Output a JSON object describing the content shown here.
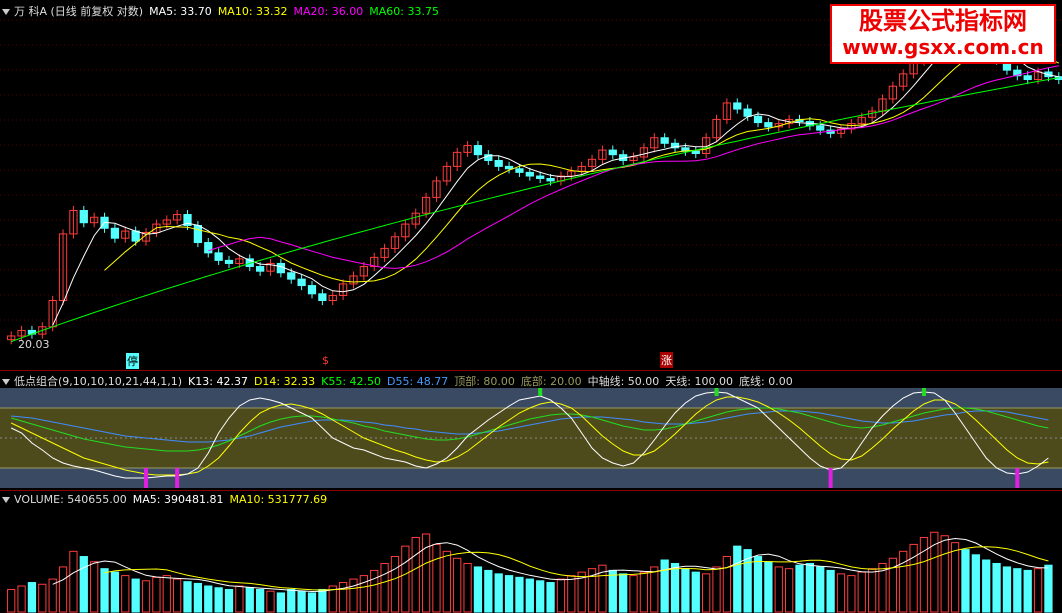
{
  "price_header": {
    "title": "万 科A (日线 前复权 对数)",
    "ma5": "MA5: 33.70",
    "ma10": "MA10: 33.32",
    "ma20": "MA20: 36.00",
    "ma60": "MA60: 33.75",
    "colors": {
      "ma5": "#ffffff",
      "ma10": "#ffff00",
      "ma20": "#ff00ff",
      "ma60": "#00ff00"
    }
  },
  "watermark": {
    "title": "股票公式指标网",
    "url": "www.gsxx.com.cn"
  },
  "low_label": "20.03",
  "markers": {
    "ting": "停",
    "jin": "$",
    "zhang": "涨"
  },
  "osc_header": {
    "name": "低点组合(9,10,10,10,21,44,1,1)",
    "k13": "K13: 42.37",
    "d14": "D14: 32.33",
    "k55": "K55: 42.50",
    "d55": "D55: 48.77",
    "top": "顶部: 80.00",
    "bottom": "底部: 20.00",
    "mid": "中轴线: 50.00",
    "sky": "天线: 100.00",
    "floor": "底线: 0.00"
  },
  "vol_header": {
    "volume": "VOLUME: 540655.00",
    "ma5": "MA5: 390481.81",
    "ma10": "MA10: 531777.69"
  },
  "chart_data": {
    "type": "candlestick",
    "price_range": [
      19.5,
      47
    ],
    "closes": [
      20.5,
      20.8,
      20.6,
      21.0,
      22.5,
      26.8,
      28.5,
      27.6,
      28.0,
      27.2,
      26.5,
      27.0,
      26.3,
      26.9,
      27.5,
      27.8,
      28.2,
      27.4,
      26.2,
      25.5,
      25.0,
      24.8,
      25.1,
      24.6,
      24.3,
      24.8,
      24.2,
      23.8,
      23.4,
      22.9,
      22.5,
      22.8,
      23.5,
      24.0,
      24.6,
      25.2,
      25.8,
      26.6,
      27.5,
      28.3,
      29.5,
      30.8,
      32.0,
      33.2,
      33.8,
      33.0,
      32.5,
      32.0,
      31.8,
      31.5,
      31.2,
      31.0,
      30.8,
      31.2,
      31.6,
      32.0,
      32.6,
      33.4,
      33.0,
      32.5,
      32.8,
      33.6,
      34.5,
      34.0,
      33.6,
      33.3,
      33.1,
      34.5,
      36.2,
      37.8,
      37.2,
      36.5,
      35.9,
      35.5,
      35.8,
      36.2,
      36.0,
      35.6,
      35.2,
      34.9,
      35.3,
      35.8,
      36.4,
      37.0,
      38.2,
      39.5,
      40.8,
      42.2,
      43.5,
      44.8,
      45.6,
      46.2,
      45.6,
      44.6,
      43.4,
      42.3,
      41.2,
      40.6,
      40.2,
      41.0,
      40.5,
      40.2
    ],
    "opens": [
      20.3,
      20.5,
      20.8,
      20.6,
      21.0,
      22.5,
      26.8,
      28.5,
      27.6,
      28.0,
      27.2,
      26.5,
      27.0,
      26.3,
      26.9,
      27.5,
      27.8,
      28.2,
      27.4,
      26.2,
      25.5,
      25.0,
      24.8,
      25.1,
      24.6,
      24.3,
      24.8,
      24.2,
      23.8,
      23.4,
      22.9,
      22.5,
      22.8,
      23.5,
      24.0,
      24.6,
      25.2,
      25.8,
      26.6,
      27.5,
      28.3,
      29.5,
      30.8,
      32.0,
      33.2,
      33.8,
      33.0,
      32.5,
      32.0,
      31.8,
      31.5,
      31.2,
      31.0,
      30.8,
      31.2,
      31.6,
      32.0,
      32.6,
      33.4,
      33.0,
      32.5,
      32.8,
      33.6,
      34.5,
      34.0,
      33.6,
      33.3,
      33.1,
      34.5,
      36.2,
      37.8,
      37.2,
      36.5,
      35.9,
      35.5,
      35.8,
      36.2,
      36.0,
      35.6,
      35.2,
      34.9,
      35.3,
      35.8,
      36.4,
      37.0,
      38.2,
      39.5,
      40.8,
      42.2,
      43.5,
      44.8,
      45.6,
      46.2,
      45.6,
      44.6,
      43.4,
      42.3,
      41.2,
      40.6,
      40.2,
      41.0,
      40.5
    ],
    "ma60": [
      20.2,
      20.4,
      20.6,
      20.8,
      21.0,
      21.2,
      21.4,
      21.6,
      21.8,
      22.0,
      22.2,
      22.4,
      22.6,
      22.8,
      23.0,
      23.2,
      23.4,
      23.6,
      23.8,
      24.0,
      24.2,
      24.4,
      24.6,
      24.8,
      25.0,
      25.2,
      25.4,
      25.6,
      25.8,
      26.0,
      26.2,
      26.4,
      26.6,
      26.8,
      27.0,
      27.2,
      27.4,
      27.6,
      27.8,
      28.0,
      28.2,
      28.4,
      28.6,
      28.8,
      29.0,
      29.2,
      29.4,
      29.6,
      29.8,
      30.0,
      30.2,
      30.4,
      30.6,
      30.8,
      31.0,
      31.2,
      31.4,
      31.6,
      31.8,
      32.0,
      32.2,
      32.4,
      32.6,
      32.8,
      33.0,
      33.2,
      33.4,
      33.6,
      33.8,
      34.0,
      34.2,
      34.4,
      34.6,
      34.8,
      35.0,
      35.2,
      35.4,
      35.6,
      35.8,
      36.0,
      36.2,
      36.4,
      36.6,
      36.8,
      37.0,
      37.2,
      37.4,
      37.6,
      37.8,
      38.0,
      38.2,
      38.4,
      38.6,
      38.8,
      39.0,
      39.2,
      39.4,
      39.6,
      39.8,
      40.0,
      40.2,
      40.4
    ],
    "osc": {
      "range": [
        0,
        100
      ],
      "k": [
        60,
        55,
        45,
        38,
        30,
        25,
        22,
        20,
        18,
        15,
        12,
        10,
        10,
        10,
        11,
        12,
        12,
        14,
        20,
        35,
        55,
        70,
        82,
        88,
        90,
        88,
        85,
        80,
        75,
        70,
        60,
        50,
        45,
        40,
        38,
        34,
        30,
        28,
        26,
        22,
        20,
        24,
        30,
        40,
        52,
        60,
        68,
        75,
        82,
        88,
        90,
        92,
        88,
        80,
        70,
        55,
        40,
        30,
        25,
        22,
        25,
        35,
        48,
        62,
        75,
        85,
        92,
        95,
        96,
        95,
        90,
        85,
        80,
        70,
        60,
        50,
        40,
        30,
        22,
        18,
        20,
        30,
        45,
        60,
        72,
        82,
        90,
        95,
        96,
        95,
        88,
        75,
        60,
        45,
        30,
        20,
        15,
        14,
        16,
        22,
        30
      ],
      "d": [
        65,
        60,
        55,
        50,
        45,
        40,
        35,
        30,
        27,
        24,
        21,
        18,
        16,
        14,
        13,
        13,
        13,
        14,
        16,
        22,
        30,
        42,
        55,
        66,
        75,
        80,
        83,
        84,
        82,
        79,
        74,
        68,
        62,
        56,
        50,
        46,
        42,
        38,
        35,
        31,
        28,
        26,
        27,
        31,
        37,
        45,
        53,
        61,
        68,
        75,
        80,
        84,
        86,
        84,
        80,
        72,
        62,
        52,
        44,
        37,
        33,
        33,
        37,
        45,
        54,
        64,
        74,
        82,
        88,
        91,
        91,
        89,
        86,
        81,
        75,
        68,
        60,
        51,
        42,
        34,
        29,
        28,
        32,
        40,
        49,
        59,
        68,
        77,
        84,
        88,
        88,
        84,
        77,
        68,
        58,
        48,
        38,
        30,
        25,
        24,
        26
      ],
      "k55": [
        70,
        67,
        64,
        61,
        58,
        55,
        52,
        49,
        47,
        45,
        43,
        41,
        40,
        39,
        38,
        37,
        37,
        37,
        38,
        40,
        43,
        47,
        52,
        57,
        62,
        66,
        69,
        71,
        72,
        72,
        71,
        69,
        67,
        65,
        62,
        60,
        57,
        55,
        53,
        51,
        49,
        48,
        48,
        49,
        51,
        54,
        57,
        60,
        63,
        66,
        69,
        71,
        73,
        74,
        74,
        73,
        71,
        68,
        65,
        62,
        60,
        58,
        58,
        59,
        61,
        64,
        67,
        70,
        73,
        76,
        78,
        79,
        80,
        80,
        79,
        77,
        75,
        72,
        69,
        66,
        63,
        61,
        60,
        61,
        63,
        66,
        69,
        72,
        75,
        77,
        79,
        80,
        80,
        79,
        77,
        74,
        71,
        68,
        65,
        62,
        60
      ],
      "d55": [
        72,
        71,
        70,
        68,
        66,
        64,
        62,
        60,
        58,
        56,
        54,
        52,
        51,
        50,
        49,
        48,
        47,
        46,
        46,
        46,
        47,
        48,
        50,
        52,
        55,
        58,
        61,
        63,
        65,
        67,
        68,
        68,
        68,
        67,
        66,
        65,
        63,
        62,
        60,
        59,
        57,
        56,
        55,
        54,
        54,
        55,
        56,
        57,
        59,
        61,
        63,
        65,
        67,
        69,
        70,
        71,
        71,
        71,
        70,
        69,
        68,
        66,
        65,
        64,
        64,
        64,
        65,
        66,
        68,
        70,
        72,
        74,
        75,
        76,
        77,
        77,
        77,
        76,
        75,
        73,
        71,
        69,
        67,
        66,
        65,
        65,
        66,
        67,
        69,
        71,
        73,
        74,
        76,
        77,
        77,
        77,
        76,
        74,
        72,
        70,
        68
      ]
    },
    "volume_range": [
      0,
      1200000
    ],
    "volume": [
      260,
      300,
      340,
      320,
      380,
      520,
      700,
      640,
      580,
      500,
      460,
      420,
      380,
      360,
      400,
      420,
      380,
      350,
      330,
      300,
      280,
      260,
      300,
      280,
      260,
      240,
      220,
      260,
      240,
      220,
      260,
      300,
      340,
      380,
      420,
      480,
      560,
      640,
      760,
      860,
      900,
      780,
      700,
      620,
      560,
      520,
      480,
      440,
      420,
      400,
      380,
      360,
      340,
      380,
      420,
      460,
      500,
      540,
      480,
      440,
      420,
      460,
      520,
      600,
      560,
      500,
      460,
      440,
      520,
      640,
      760,
      720,
      640,
      580,
      520,
      500,
      540,
      560,
      520,
      480,
      440,
      420,
      460,
      500,
      560,
      620,
      700,
      780,
      860,
      920,
      880,
      800,
      720,
      660,
      600,
      560,
      520,
      500,
      480,
      500,
      540
    ]
  }
}
